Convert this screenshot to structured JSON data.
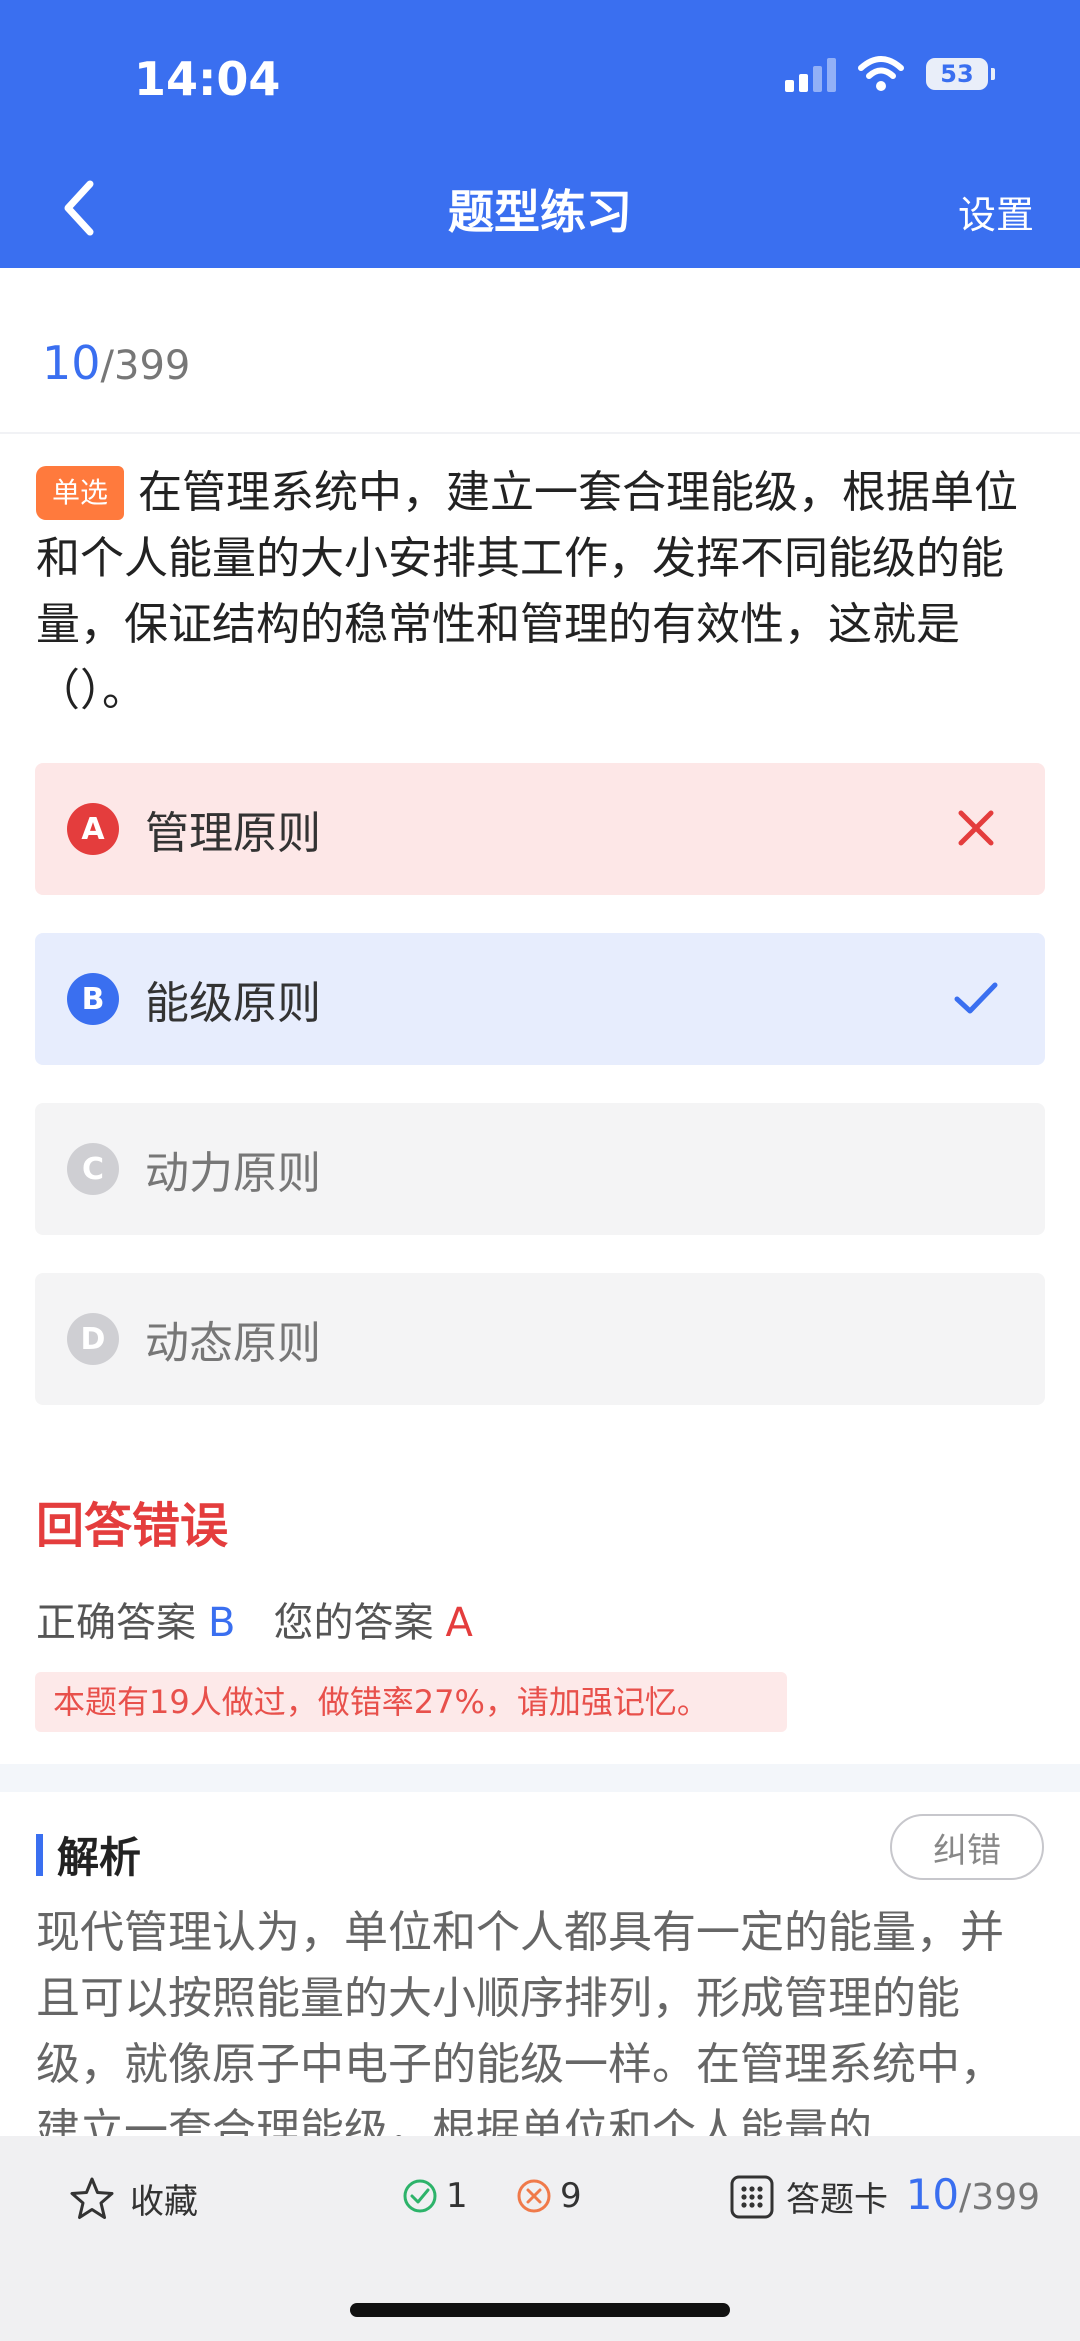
{
  "status_bar": {
    "time": "14:04",
    "battery": "53"
  },
  "nav": {
    "title": "题型练习",
    "settings_label": "设置"
  },
  "progress": {
    "current": "10",
    "total": "/399"
  },
  "question": {
    "type_tag": "单选",
    "text": "在管理系统中，建立一套合理能级，根据单位和个人能量的大小安排其工作，发挥不同能级的能量，保证结构的稳常性和管理的有效性，这就是（）。"
  },
  "options": [
    {
      "letter": "A",
      "text": "管理原则",
      "state": "wrong"
    },
    {
      "letter": "B",
      "text": "能级原则",
      "state": "correct"
    },
    {
      "letter": "C",
      "text": "动力原则",
      "state": "none"
    },
    {
      "letter": "D",
      "text": "动态原则",
      "state": "none"
    }
  ],
  "result": {
    "title": "回答错误",
    "correct_label": "正确答案",
    "correct_value": "B",
    "yours_label": "您的答案",
    "yours_value": "A",
    "stat_text": "本题有19人做过，做错率27%，请加强记忆。"
  },
  "analysis": {
    "title": "解析",
    "correction_label": "纠错",
    "text": "现代管理认为，单位和个人都具有一定的能量，并且可以按照能量的大小顺序排列，形成管理的能级，就像原子中电子的能级一样。在管理系统中，建立一套合理能级，根据单位和个人能量的"
  },
  "bottom_bar": {
    "favorite_label": "收藏",
    "correct_count": "1",
    "wrong_count": "9",
    "answer_card_label": "答题卡",
    "progress_current": "10",
    "progress_total": "/399"
  },
  "colors": {
    "brand": "#3a6ff0",
    "error": "#e43d3d",
    "tag": "#ff7a3d",
    "success": "#2db36a"
  }
}
